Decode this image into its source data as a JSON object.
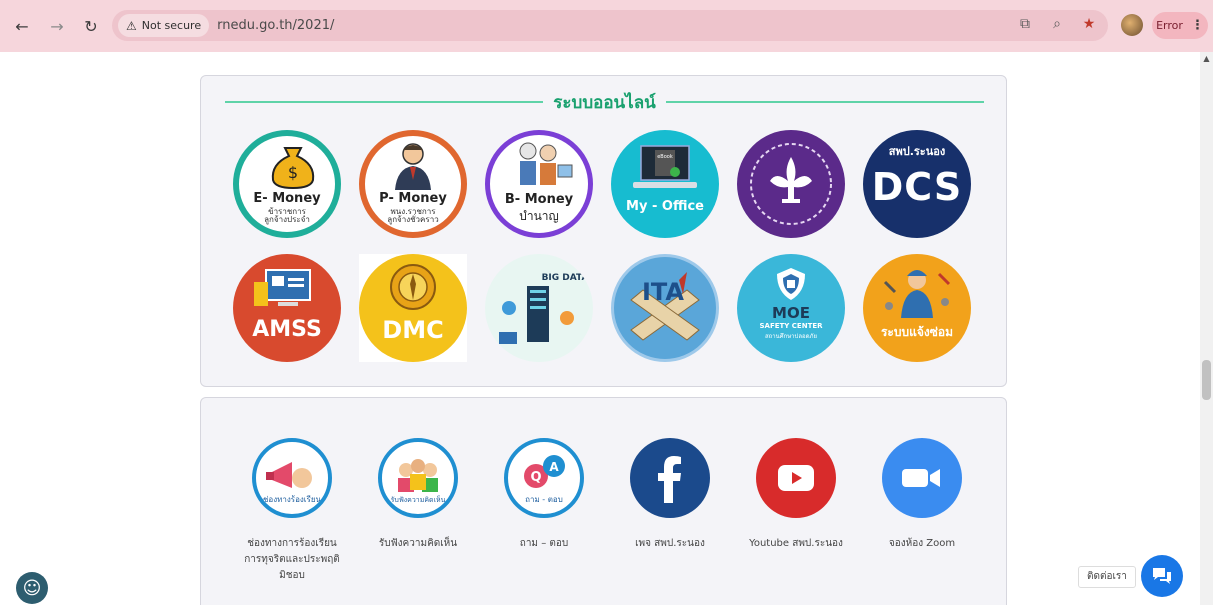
{
  "browser": {
    "back_icon": "arrow-left-icon",
    "forward_icon": "arrow-right-icon",
    "reload_icon": "reload-icon",
    "security_label": "Not secure",
    "url": "rnedu.go.th/2021/",
    "error_label": "Error"
  },
  "section_online": {
    "heading": "ระบบออนไลน์",
    "tiles": [
      {
        "title": "E- Money",
        "sub1": "ข้าราชการ",
        "sub2": "ลูกจ้างประจำ",
        "color": "#1fae9a"
      },
      {
        "title": "P- Money",
        "sub1": "พนง.ราชการ",
        "sub2": "ลูกจ้างชั่วคราว",
        "color": "#e0672f"
      },
      {
        "title": "B- Money",
        "sub1": "บำนาญ",
        "color": "#7b3fd6"
      },
      {
        "title": "My - Office",
        "sub1": "eBook",
        "color": "#17bcd0"
      },
      {
        "title": "",
        "color": "#5b2a8a"
      },
      {
        "title": "DCS",
        "sub1": "สพป.ระนอง",
        "color": "#17306b"
      },
      {
        "title": "AMSS",
        "color": "#d84a2e"
      },
      {
        "title": "DMC",
        "color": "#f4c21b"
      },
      {
        "title": "BIG DATA",
        "color": "#e8f6f2"
      },
      {
        "title": "ITA",
        "color": "#5aa6d9"
      },
      {
        "title": "MOE",
        "sub1": "SAFETY CENTER",
        "sub2": "สถานศึกษาปลอดภัย",
        "color": "#3ab7d9"
      },
      {
        "title": "ระบบแจ้งซ่อม",
        "color": "#f2a21b"
      }
    ]
  },
  "section_social": {
    "items": [
      {
        "label_1": "ช่องทางการร้องเรียน",
        "label_2": "การทุจริตและประพฤติ",
        "label_3": "มิชอบ",
        "icon_text": "ช่องทางร้องเรียน",
        "color": "#1f8fd1"
      },
      {
        "label_1": "รับฟังความคิดเห็น",
        "icon_text": "รับฟังความคิดเห็น",
        "color": "#1f8fd1"
      },
      {
        "label_1": "ถาม – ตอบ",
        "icon_text": "ถาม - ตอบ",
        "color": "#1f8fd1"
      },
      {
        "label_1": "เพจ สพป.ระนอง",
        "color": "#1b4a8c"
      },
      {
        "label_1": "Youtube สพป.ระนอง",
        "color": "#d82b2b"
      },
      {
        "label_1": "จองห้อง Zoom",
        "color": "#3a8cf0"
      }
    ]
  },
  "widgets": {
    "contact_label": "ติดต่อเรา",
    "accessibility_icon": "accessibility-icon",
    "chat_icon": "chat-icon"
  }
}
